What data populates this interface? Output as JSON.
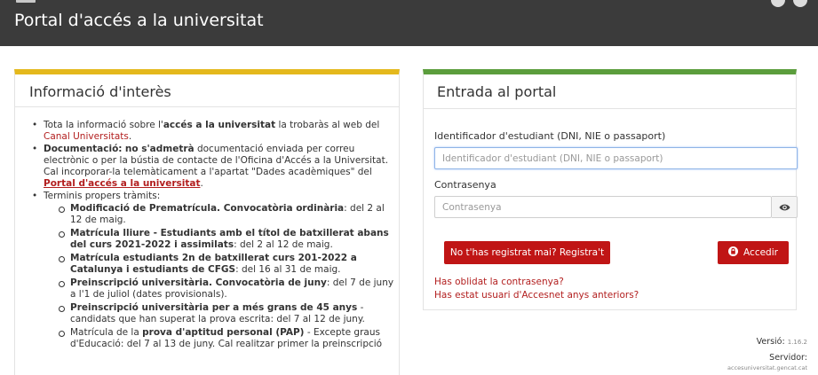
{
  "header": {
    "title": "Portal d'accés a la universitat"
  },
  "info_panel": {
    "title": "Informació d'interès",
    "items": {
      "canal": {
        "pre": "Tota la informació sobre l'",
        "bold": "accés a la universitat",
        "mid": " la trobaràs al web del ",
        "link": "Canal Universitats",
        "post": "."
      },
      "documentacio": {
        "bold1": "Documentació:",
        "bold2": "no s'admetrà",
        "text": " documentació enviada per correu electrònic o per la bústia de contacte de l'Oficina d'Accés a la Universitat. Cal incorporar-la telemàticament a l'apartat \"Dades acadèmiques\" del ",
        "link": "Portal d'accés a la universitat",
        "post": "."
      },
      "terminis": {
        "label": "Terminis propers tràmits:",
        "sub": [
          {
            "bold": "Modificació de Prematrícula. Convocatòria ordinària",
            "text": ": del 2 al 12 de maig."
          },
          {
            "bold": "Matrícula lliure - Estudiants amb el títol de batxillerat abans del curs 2021-2022 i assimilats",
            "text": ": del 2 al 12 de maig."
          },
          {
            "bold": "Matrícula estudiants 2n de batxillerat curs 201-2022 a Catalunya i estudiants de CFGS",
            "text": ": del 16 al 31 de maig."
          },
          {
            "bold": "Preinscripció universitària. Convocatòria de juny",
            "text": ": del 7 de juny a l'1 de juliol (dates provisionals)."
          },
          {
            "bold": "Preinscripció universitària per a més grans de 45 anys",
            "text": " - candidats que han superat la prova escrita: del 7 al 12 de juny."
          },
          {
            "pre": "Matrícula de la ",
            "bold": "prova d'aptitud personal (PAP)",
            "text": " - Excepte graus d'Educació: del 7 al 13 de juny. Cal realitzar primer la preinscripció"
          }
        ]
      }
    }
  },
  "login_panel": {
    "title": "Entrada al portal",
    "id_label": "Identificador d'estudiant (DNI, NIE o passaport)",
    "id_placeholder": "Identificador d'estudiant (DNI, NIE o passaport)",
    "password_label": "Contrasenya",
    "password_placeholder": "Contrasenya",
    "register_button": "No t'has registrat mai? Registra't",
    "login_button": "Accedir",
    "forgot_link": "Has oblidat la contrasenya?",
    "accesnet_link": "Has estat usuari d'Accesnet anys anteriors?"
  },
  "footer": {
    "version_label": "Versió:",
    "version_value": "1.16.2",
    "server_label": "Servidor:",
    "server_value": "accesuniversitat.gencat.cat"
  },
  "colors": {
    "header_bg": "#3b3b3b",
    "info_accent": "#e4b81c",
    "login_accent": "#5b9d3c",
    "button_red": "#c01515",
    "link_red": "#b21e1e"
  },
  "icons": [
    "eye-icon",
    "lock-icon"
  ]
}
